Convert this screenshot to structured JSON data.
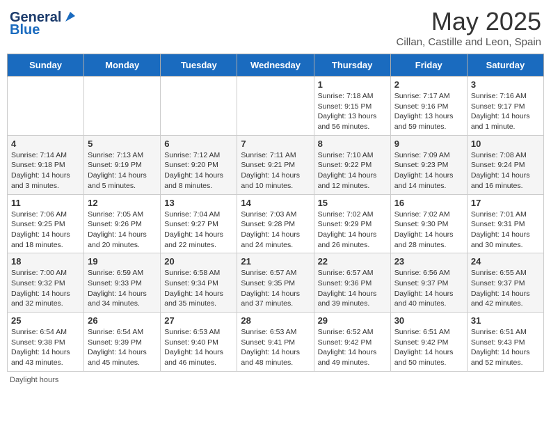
{
  "header": {
    "logo_line1": "General",
    "logo_line2": "Blue",
    "title": "May 2025",
    "subtitle": "Cillan, Castille and Leon, Spain"
  },
  "days_of_week": [
    "Sunday",
    "Monday",
    "Tuesday",
    "Wednesday",
    "Thursday",
    "Friday",
    "Saturday"
  ],
  "weeks": [
    [
      {
        "day": "",
        "info": ""
      },
      {
        "day": "",
        "info": ""
      },
      {
        "day": "",
        "info": ""
      },
      {
        "day": "",
        "info": ""
      },
      {
        "day": "1",
        "info": "Sunrise: 7:18 AM\nSunset: 9:15 PM\nDaylight: 13 hours\nand 56 minutes."
      },
      {
        "day": "2",
        "info": "Sunrise: 7:17 AM\nSunset: 9:16 PM\nDaylight: 13 hours\nand 59 minutes."
      },
      {
        "day": "3",
        "info": "Sunrise: 7:16 AM\nSunset: 9:17 PM\nDaylight: 14 hours\nand 1 minute."
      }
    ],
    [
      {
        "day": "4",
        "info": "Sunrise: 7:14 AM\nSunset: 9:18 PM\nDaylight: 14 hours\nand 3 minutes."
      },
      {
        "day": "5",
        "info": "Sunrise: 7:13 AM\nSunset: 9:19 PM\nDaylight: 14 hours\nand 5 minutes."
      },
      {
        "day": "6",
        "info": "Sunrise: 7:12 AM\nSunset: 9:20 PM\nDaylight: 14 hours\nand 8 minutes."
      },
      {
        "day": "7",
        "info": "Sunrise: 7:11 AM\nSunset: 9:21 PM\nDaylight: 14 hours\nand 10 minutes."
      },
      {
        "day": "8",
        "info": "Sunrise: 7:10 AM\nSunset: 9:22 PM\nDaylight: 14 hours\nand 12 minutes."
      },
      {
        "day": "9",
        "info": "Sunrise: 7:09 AM\nSunset: 9:23 PM\nDaylight: 14 hours\nand 14 minutes."
      },
      {
        "day": "10",
        "info": "Sunrise: 7:08 AM\nSunset: 9:24 PM\nDaylight: 14 hours\nand 16 minutes."
      }
    ],
    [
      {
        "day": "11",
        "info": "Sunrise: 7:06 AM\nSunset: 9:25 PM\nDaylight: 14 hours\nand 18 minutes."
      },
      {
        "day": "12",
        "info": "Sunrise: 7:05 AM\nSunset: 9:26 PM\nDaylight: 14 hours\nand 20 minutes."
      },
      {
        "day": "13",
        "info": "Sunrise: 7:04 AM\nSunset: 9:27 PM\nDaylight: 14 hours\nand 22 minutes."
      },
      {
        "day": "14",
        "info": "Sunrise: 7:03 AM\nSunset: 9:28 PM\nDaylight: 14 hours\nand 24 minutes."
      },
      {
        "day": "15",
        "info": "Sunrise: 7:02 AM\nSunset: 9:29 PM\nDaylight: 14 hours\nand 26 minutes."
      },
      {
        "day": "16",
        "info": "Sunrise: 7:02 AM\nSunset: 9:30 PM\nDaylight: 14 hours\nand 28 minutes."
      },
      {
        "day": "17",
        "info": "Sunrise: 7:01 AM\nSunset: 9:31 PM\nDaylight: 14 hours\nand 30 minutes."
      }
    ],
    [
      {
        "day": "18",
        "info": "Sunrise: 7:00 AM\nSunset: 9:32 PM\nDaylight: 14 hours\nand 32 minutes."
      },
      {
        "day": "19",
        "info": "Sunrise: 6:59 AM\nSunset: 9:33 PM\nDaylight: 14 hours\nand 34 minutes."
      },
      {
        "day": "20",
        "info": "Sunrise: 6:58 AM\nSunset: 9:34 PM\nDaylight: 14 hours\nand 35 minutes."
      },
      {
        "day": "21",
        "info": "Sunrise: 6:57 AM\nSunset: 9:35 PM\nDaylight: 14 hours\nand 37 minutes."
      },
      {
        "day": "22",
        "info": "Sunrise: 6:57 AM\nSunset: 9:36 PM\nDaylight: 14 hours\nand 39 minutes."
      },
      {
        "day": "23",
        "info": "Sunrise: 6:56 AM\nSunset: 9:37 PM\nDaylight: 14 hours\nand 40 minutes."
      },
      {
        "day": "24",
        "info": "Sunrise: 6:55 AM\nSunset: 9:37 PM\nDaylight: 14 hours\nand 42 minutes."
      }
    ],
    [
      {
        "day": "25",
        "info": "Sunrise: 6:54 AM\nSunset: 9:38 PM\nDaylight: 14 hours\nand 43 minutes."
      },
      {
        "day": "26",
        "info": "Sunrise: 6:54 AM\nSunset: 9:39 PM\nDaylight: 14 hours\nand 45 minutes."
      },
      {
        "day": "27",
        "info": "Sunrise: 6:53 AM\nSunset: 9:40 PM\nDaylight: 14 hours\nand 46 minutes."
      },
      {
        "day": "28",
        "info": "Sunrise: 6:53 AM\nSunset: 9:41 PM\nDaylight: 14 hours\nand 48 minutes."
      },
      {
        "day": "29",
        "info": "Sunrise: 6:52 AM\nSunset: 9:42 PM\nDaylight: 14 hours\nand 49 minutes."
      },
      {
        "day": "30",
        "info": "Sunrise: 6:51 AM\nSunset: 9:42 PM\nDaylight: 14 hours\nand 50 minutes."
      },
      {
        "day": "31",
        "info": "Sunrise: 6:51 AM\nSunset: 9:43 PM\nDaylight: 14 hours\nand 52 minutes."
      }
    ]
  ],
  "footer": "Daylight hours"
}
